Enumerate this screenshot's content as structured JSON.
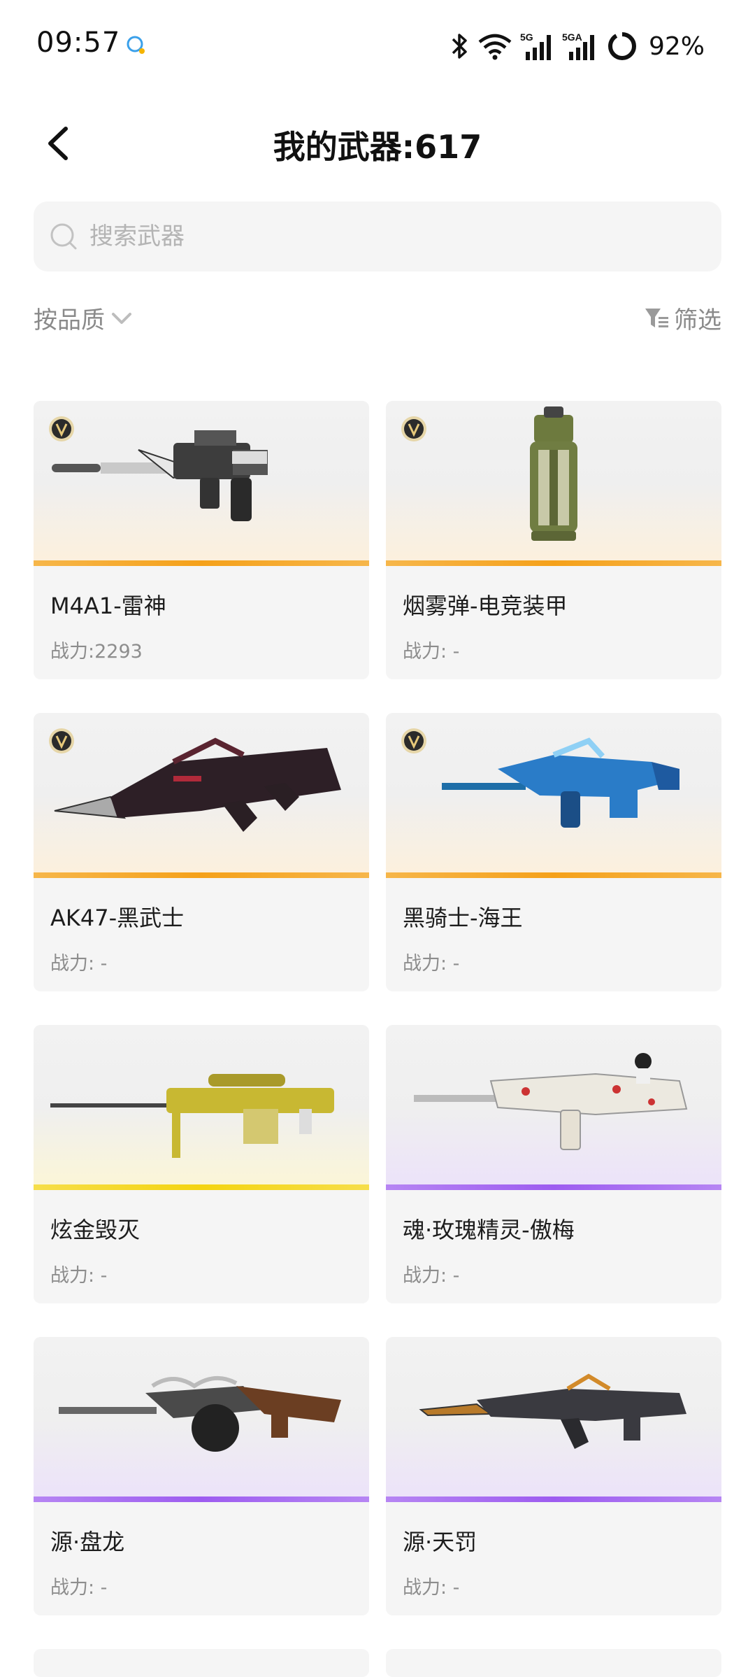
{
  "status_bar": {
    "time": "09:57",
    "battery_percent": "92%",
    "network_labels": [
      "5G",
      "5GA"
    ]
  },
  "header": {
    "title": "我的武器:617"
  },
  "search": {
    "placeholder": "搜索武器",
    "value": ""
  },
  "sort": {
    "label": "按品质"
  },
  "filter": {
    "label": "筛选"
  },
  "weapons": [
    {
      "name": "M4A1-雷神",
      "power": "战力:2293",
      "rarity": "gold",
      "has_v_badge": true
    },
    {
      "name": "烟雾弹-电竞装甲",
      "power": "战力: -",
      "rarity": "gold",
      "has_v_badge": true
    },
    {
      "name": "AK47-黑武士",
      "power": "战力: -",
      "rarity": "gold",
      "has_v_badge": true
    },
    {
      "name": "黑骑士-海王",
      "power": "战力: -",
      "rarity": "gold",
      "has_v_badge": true
    },
    {
      "name": "炫金毁灭",
      "power": "战力: -",
      "rarity": "yellow",
      "has_v_badge": false
    },
    {
      "name": "魂·玫瑰精灵-傲梅",
      "power": "战力: -",
      "rarity": "purple",
      "has_v_badge": false
    },
    {
      "name": "源·盘龙",
      "power": "战力: -",
      "rarity": "purple",
      "has_v_badge": false
    },
    {
      "name": "源·天罚",
      "power": "战力: -",
      "rarity": "purple",
      "has_v_badge": false
    }
  ],
  "colors": {
    "gold_bar": "#f5a11a",
    "yellow_bar": "#f4d411",
    "purple_bar": "#9d5cf0",
    "card_bg": "#f5f5f5",
    "muted_text": "#8a8a8a"
  }
}
